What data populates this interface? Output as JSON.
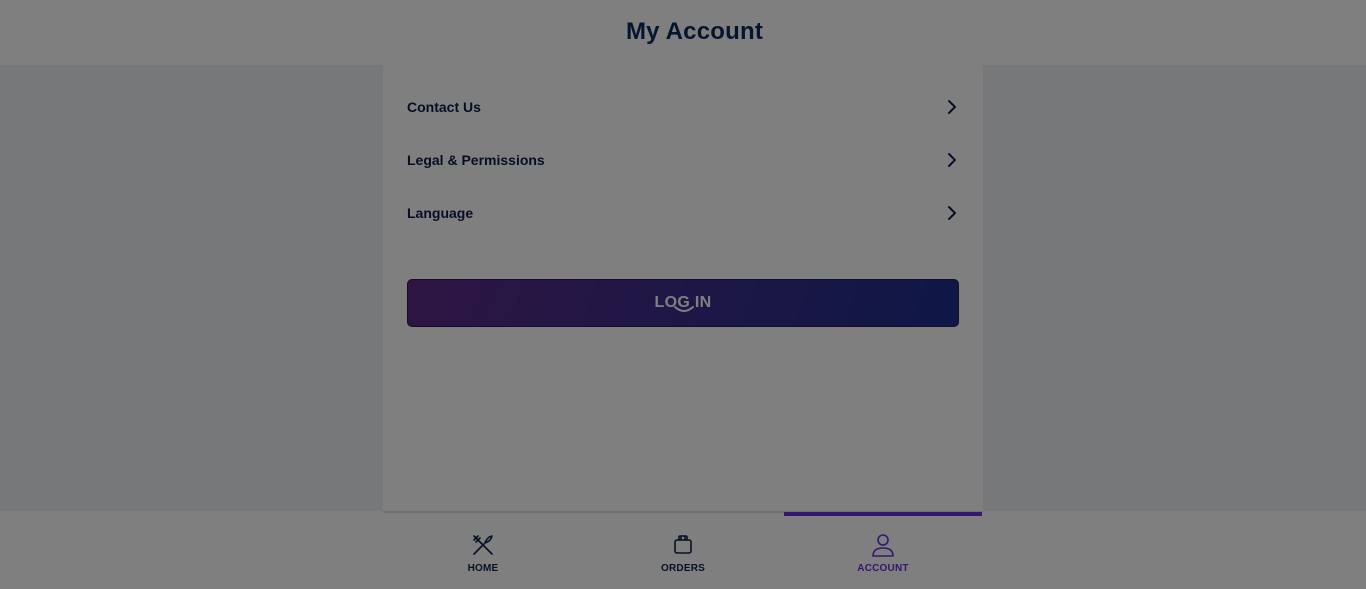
{
  "header": {
    "title": "My Account"
  },
  "menu": {
    "items": [
      {
        "label": "Contact Us",
        "icon": "chevron-right-icon"
      },
      {
        "label": "Legal & Permissions",
        "icon": "chevron-right-icon"
      },
      {
        "label": "Language",
        "icon": "chevron-right-icon"
      }
    ]
  },
  "login": {
    "label": "LOG IN",
    "state": "loading"
  },
  "bottom_nav": {
    "tabs": [
      {
        "label": "HOME",
        "icon": "utensils-icon",
        "active": false
      },
      {
        "label": "ORDERS",
        "icon": "bag-icon",
        "active": false
      },
      {
        "label": "ACCOUNT",
        "icon": "user-icon",
        "active": true
      }
    ]
  },
  "colors": {
    "accent": "#6a2ee0",
    "title": "#0a2a5e",
    "text": "#0f1a4a",
    "button_start": "#5c2a86",
    "button_end": "#1c2e8c"
  }
}
